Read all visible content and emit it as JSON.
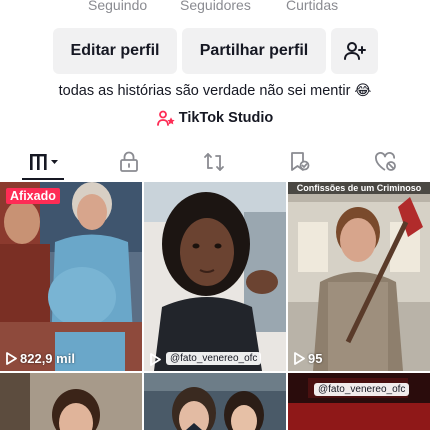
{
  "stats": {
    "following_label": "Seguindo",
    "followers_label": "Seguidores",
    "likes_label": "Curtidas"
  },
  "actions": {
    "edit_profile": "Editar perfil",
    "share_profile": "Partilhar perfil",
    "add_friend_icon": "person-add-icon"
  },
  "bio": "todas as histórias são verdade não sei mentir 😂",
  "studio_link": "TikTok Studio",
  "tabs": [
    {
      "icon": "grid-videos-icon",
      "active": true
    },
    {
      "icon": "lock-icon"
    },
    {
      "icon": "repost-icon"
    },
    {
      "icon": "saved-icon"
    },
    {
      "icon": "liked-icon"
    }
  ],
  "videos": [
    {
      "views": "822,9 mil",
      "badge": "Afixado"
    },
    {
      "views": "",
      "handle": "@fato_venereo_ofc"
    },
    {
      "views": "95",
      "overlay_title": "Confissões de um Criminoso"
    },
    {
      "views": ""
    },
    {
      "views": ""
    },
    {
      "views": "",
      "handle": "@fato_venereo_ofc"
    }
  ],
  "colors": {
    "accent": "#fe2c55",
    "button_bg": "#f1f1f2",
    "text": "#161823",
    "muted": "#8a8b91"
  }
}
